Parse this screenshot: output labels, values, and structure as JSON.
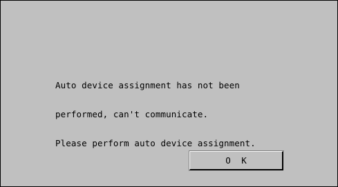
{
  "dialog": {
    "message_lines": [
      "Auto device assignment has not been",
      "performed, can't communicate.",
      "Please perform auto device assignment."
    ],
    "ok_label": "O K"
  },
  "colors": {
    "background": "#c0c0c0",
    "text": "#000000",
    "button_highlight": "#ffffff",
    "button_shadow": "#000000"
  }
}
